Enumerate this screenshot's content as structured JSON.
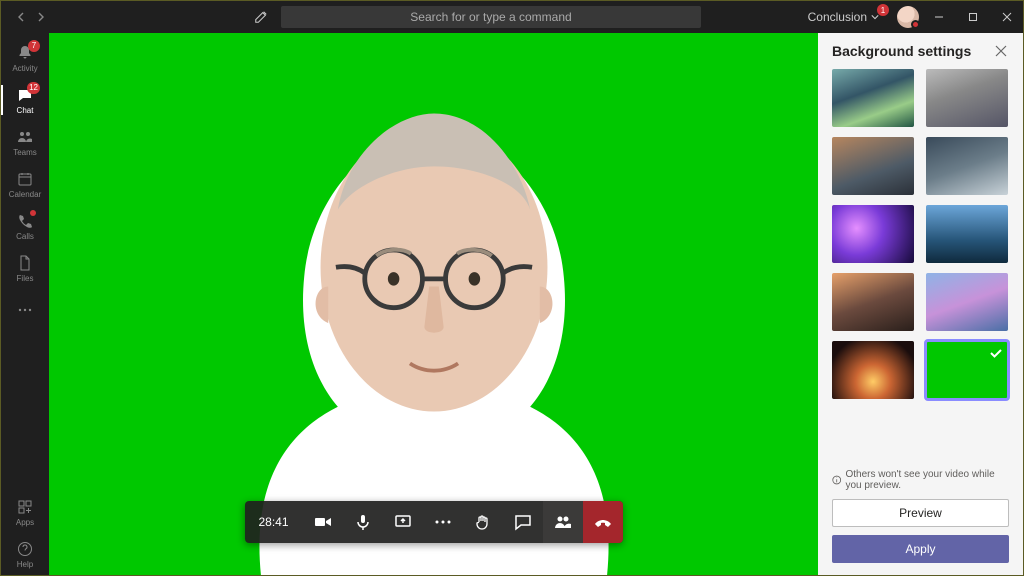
{
  "search": {
    "placeholder": "Search for or type a command"
  },
  "tenant": {
    "name": "Conclusion",
    "badge": "1"
  },
  "rail": {
    "items": [
      {
        "label": "Activity",
        "badge": "7"
      },
      {
        "label": "Chat",
        "badge": "12",
        "active": true
      },
      {
        "label": "Teams"
      },
      {
        "label": "Calendar"
      },
      {
        "label": "Calls",
        "dot": true
      },
      {
        "label": "Files"
      }
    ],
    "apps_label": "Apps",
    "help_label": "Help"
  },
  "call": {
    "duration": "28:41"
  },
  "panel": {
    "title": "Background settings",
    "hint": "Others won't see your video while you preview.",
    "preview_label": "Preview",
    "apply_label": "Apply",
    "selected_index": 9
  }
}
